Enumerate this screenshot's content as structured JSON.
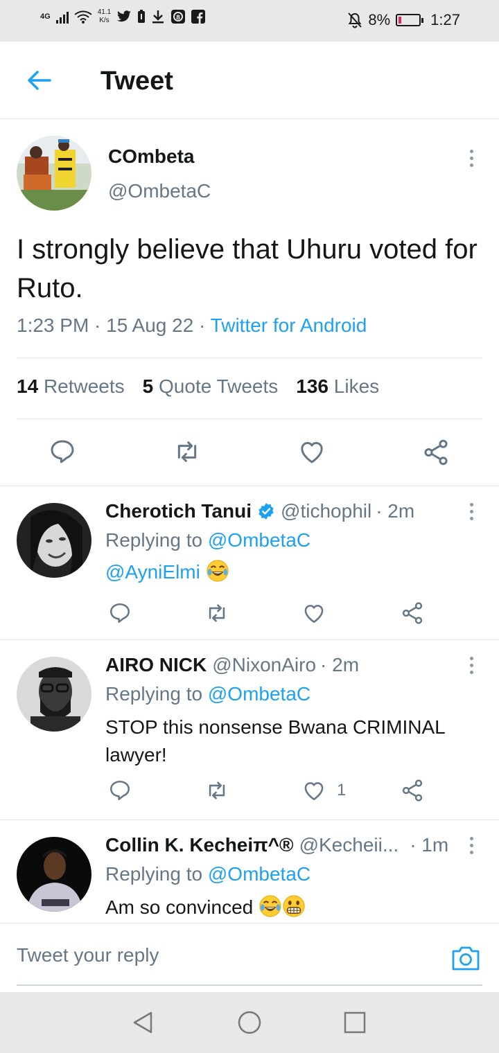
{
  "status_bar": {
    "network": "4G",
    "speed_value": "41.1",
    "speed_unit": "K/s",
    "battery": "8%",
    "time": "1:27"
  },
  "header": {
    "title": "Tweet"
  },
  "tweet": {
    "author_name": "COmbeta",
    "author_handle": "@OmbetaC",
    "text": "I strongly believe that Uhuru voted for Ruto.",
    "time": "1:23 PM · 15 Aug 22 · ",
    "source": "Twitter for Android",
    "stats": {
      "retweets_count": "14",
      "retweets_label": "Retweets",
      "quotes_count": "5",
      "quotes_label": "Quote Tweets",
      "likes_count": "136",
      "likes_label": "Likes"
    }
  },
  "replies": [
    {
      "name": "Cherotich Tanui",
      "verified": true,
      "handle": "@tichophil",
      "time": "· 2m",
      "replying_prefix": "Replying to",
      "replying_to": "@OmbetaC",
      "mention": "@AyniElmi",
      "text": "",
      "emojis": [
        "tears-of-joy-emoji"
      ],
      "likes": ""
    },
    {
      "name": "AIRO NICK",
      "verified": false,
      "handle": "@NixonAiro",
      "time": "· 2m",
      "replying_prefix": "Replying to",
      "replying_to": "@OmbetaC",
      "text": "STOP this nonsense Bwana CRIMINAL lawyer!",
      "likes": "1"
    },
    {
      "name": "Collin K. Kecheiπ^®",
      "verified": false,
      "handle": "@Kecheii...",
      "time": "· 1m",
      "replying_prefix": "Replying to",
      "replying_to": "@OmbetaC",
      "text": "Am so convinced ",
      "emojis": [
        "tears-of-joy-emoji",
        "grimacing-emoji"
      ]
    }
  ],
  "composer": {
    "placeholder": "Tweet your reply"
  },
  "colors": {
    "accent": "#1da1f2",
    "muted": "#657786",
    "text": "#14171a"
  }
}
